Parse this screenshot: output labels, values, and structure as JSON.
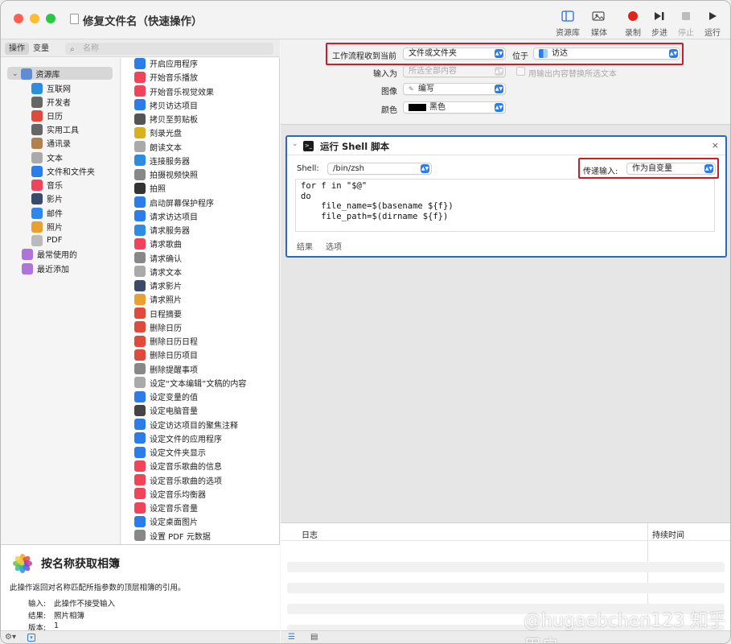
{
  "window": {
    "title": "修复文件名（快速操作）"
  },
  "toolbar": [
    {
      "label": "资源库",
      "icon": "library-icon",
      "enabled": true
    },
    {
      "label": "媒体",
      "icon": "media-icon",
      "enabled": true
    },
    {
      "label": "录制",
      "icon": "record-icon",
      "enabled": true
    },
    {
      "label": "步进",
      "icon": "step-icon",
      "enabled": true
    },
    {
      "label": "停止",
      "icon": "stop-icon",
      "enabled": false
    },
    {
      "label": "运行",
      "icon": "run-icon",
      "enabled": true
    }
  ],
  "library": {
    "tabs": [
      "操作",
      "变量"
    ],
    "active_tab": "操作",
    "search_placeholder": "名称",
    "categories": [
      {
        "label": "资源库",
        "icon": "library-icon",
        "color": "#5f8cd6"
      },
      {
        "label": "互联网",
        "icon": "globe-icon",
        "color": "#2d8de0"
      },
      {
        "label": "开发者",
        "icon": "tools-icon",
        "color": "#666666"
      },
      {
        "label": "日历",
        "icon": "calendar-icon",
        "color": "#e04a3c"
      },
      {
        "label": "实用工具",
        "icon": "utilities-icon",
        "color": "#666666"
      },
      {
        "label": "通讯录",
        "icon": "contacts-icon",
        "color": "#b08050"
      },
      {
        "label": "文本",
        "icon": "text-icon",
        "color": "#aaaaaa"
      },
      {
        "label": "文件和文件夹",
        "icon": "finder-icon",
        "color": "#2b7de9"
      },
      {
        "label": "音乐",
        "icon": "music-icon",
        "color": "#f0445a"
      },
      {
        "label": "影片",
        "icon": "movie-icon",
        "color": "#3a4a6a"
      },
      {
        "label": "邮件",
        "icon": "mail-icon",
        "color": "#2e86f0"
      },
      {
        "label": "照片",
        "icon": "photos-icon",
        "color": "#e8a030"
      },
      {
        "label": "PDF",
        "icon": "pdf-icon",
        "color": "#bbbbbb"
      },
      {
        "label": "最常使用的",
        "icon": "folder-purple-icon",
        "color": "#b073d9"
      },
      {
        "label": "最近添加",
        "icon": "folder-purple-icon",
        "color": "#b073d9"
      }
    ],
    "actions": [
      {
        "label": "开启应用程序",
        "color": "#2b7de9"
      },
      {
        "label": "开始音乐播放",
        "color": "#f0445a"
      },
      {
        "label": "开始音乐视觉效果",
        "color": "#f0445a"
      },
      {
        "label": "拷贝访达项目",
        "color": "#2b7de9"
      },
      {
        "label": "拷贝至剪贴板",
        "color": "#555555"
      },
      {
        "label": "刻录光盘",
        "color": "#d8b020"
      },
      {
        "label": "朗读文本",
        "color": "#aaaaaa"
      },
      {
        "label": "连接服务器",
        "color": "#2d8de0"
      },
      {
        "label": "拍摄视频快照",
        "color": "#888888"
      },
      {
        "label": "拍照",
        "color": "#333333"
      },
      {
        "label": "启动屏幕保护程序",
        "color": "#2b7de9"
      },
      {
        "label": "请求访达项目",
        "color": "#2b7de9"
      },
      {
        "label": "请求服务器",
        "color": "#2d8de0"
      },
      {
        "label": "请求歌曲",
        "color": "#f0445a"
      },
      {
        "label": "请求确认",
        "color": "#888888"
      },
      {
        "label": "请求文本",
        "color": "#aaaaaa"
      },
      {
        "label": "请求影片",
        "color": "#3a4a6a"
      },
      {
        "label": "请求照片",
        "color": "#e8a030"
      },
      {
        "label": "日程摘要",
        "color": "#e04a3c"
      },
      {
        "label": "删除日历",
        "color": "#e04a3c"
      },
      {
        "label": "删除日历日程",
        "color": "#e04a3c"
      },
      {
        "label": "删除日历项目",
        "color": "#e04a3c"
      },
      {
        "label": "删除提醒事项",
        "color": "#888888"
      },
      {
        "label": "设定“文本编辑”文稿的内容",
        "color": "#aaaaaa"
      },
      {
        "label": "设定变量的值",
        "color": "#2b7de9"
      },
      {
        "label": "设定电脑音量",
        "color": "#444444"
      },
      {
        "label": "设定访达项目的聚焦注释",
        "color": "#2b7de9"
      },
      {
        "label": "设定文件的应用程序",
        "color": "#2b7de9"
      },
      {
        "label": "设定文件夹显示",
        "color": "#2b7de9"
      },
      {
        "label": "设定音乐歌曲的信息",
        "color": "#f0445a"
      },
      {
        "label": "设定音乐歌曲的选项",
        "color": "#f0445a"
      },
      {
        "label": "设定音乐均衡器",
        "color": "#f0445a"
      },
      {
        "label": "设定音乐音量",
        "color": "#f0445a"
      },
      {
        "label": "设定桌面图片",
        "color": "#2b7de9"
      },
      {
        "label": "设置 PDF 元数据",
        "color": "#888888"
      }
    ]
  },
  "description": {
    "title": "按名称获取相簿",
    "text": "此操作返回对名称匹配所指参数的顶层相簿的引用。",
    "input_label": "输入:",
    "input_value": "此操作不接受输入",
    "result_label": "结果:",
    "result_value": "照片相簿",
    "version_label": "版本:",
    "version_value": "1"
  },
  "workflow": {
    "receives_label": "工作流程收到当前",
    "receives_value": "文件或文件夹",
    "in_label": "位于",
    "in_value": "访达",
    "input_is_label": "输入为",
    "input_is_value": "所选全部内容",
    "replace_label": "用输出内容替换所选文本",
    "image_label": "图像",
    "image_value": "编写",
    "color_label": "颜色",
    "color_value": "黑色",
    "color_swatch": "#000000"
  },
  "action_card": {
    "title": "运行 Shell 脚本",
    "shell_label": "Shell:",
    "shell_value": "/bin/zsh",
    "pass_label": "传递输入:",
    "pass_value": "作为自变量",
    "code": "for f in \"$@\"\ndo\n    file_name=$(basename ${f})\n    file_path=$(dirname ${f})",
    "tabs": [
      "结果",
      "选项"
    ]
  },
  "log": {
    "col1": "日志",
    "col2": "持续时间"
  },
  "watermark": "@hugaebchen123 知乎用户"
}
